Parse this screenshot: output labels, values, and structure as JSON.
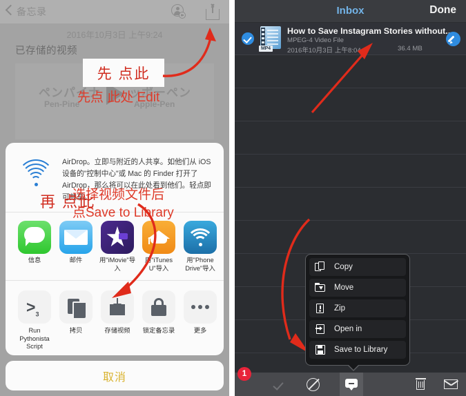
{
  "left_panel": {
    "header": {
      "back_label": "备忘录",
      "add_person_icon": "add-person-icon",
      "share_icon": "share-icon"
    },
    "date": "2016年10月3日 上午9:24",
    "note_title": "已存储的视频",
    "thumbnail": {
      "jp_left": "ペンパイナ",
      "en_left": "Pen-Pine",
      "jp_right": "ッポーペン",
      "en_right": "Apple-Pen",
      "play_icon": "play-icon"
    },
    "annotation_1": "先 点此",
    "annotation_2": "再 点此",
    "airdrop": {
      "icon": "airdrop-icon",
      "text": "AirDrop。立即与附近的人共享。如他们从 iOS 设备的\"控制中心\"或 Mac 的 Finder 打开了 AirDrop，那么将可以在此处看到他们。轻点即可共享。"
    },
    "apps": [
      {
        "label": "信息",
        "icon": "messages-icon"
      },
      {
        "label": "邮件",
        "icon": "mail-icon"
      },
      {
        "label": "用\"iMovie\"导入",
        "icon": "imovie-icon"
      },
      {
        "label": "用\"iTunes U\"导入",
        "icon": "itunes-u-icon"
      },
      {
        "label": "用\"Phone Drive\"导入",
        "icon": "phone-drive-icon"
      }
    ],
    "actions": [
      {
        "label": "Run Pythonista Script",
        "icon": "pythonista-icon"
      },
      {
        "label": "拷贝",
        "icon": "copy-icon"
      },
      {
        "label": "存储视频",
        "icon": "save-video-icon"
      },
      {
        "label": "锁定备忘录",
        "icon": "lock-icon"
      },
      {
        "label": "更多",
        "icon": "more-icon"
      }
    ],
    "cancel_label": "取消"
  },
  "right_panel": {
    "header": {
      "title": "Inbox",
      "done_label": "Done"
    },
    "file": {
      "name": "How to Save Instagram Stories without..",
      "type": "MPEG-4 Video File",
      "date": "2016年10月3日 上午8:04",
      "size": "36.4 MB",
      "file_icon": "mp4-file-icon",
      "check_icon": "checkmark-icon",
      "edit_icon": "pencil-icon"
    },
    "annotation_edit": "先点 此处 Edit",
    "annotation_save": "选择视频文件后\n点Save to Library",
    "annotation_save_line1": "选择视频文件后",
    "annotation_save_line2": "点Save to Library",
    "context_menu": [
      {
        "label": "Copy",
        "icon": "copy-icon"
      },
      {
        "label": "Move",
        "icon": "folder-move-icon"
      },
      {
        "label": "Zip",
        "icon": "zip-icon"
      },
      {
        "label": "Open in",
        "icon": "open-in-icon"
      },
      {
        "label": "Save to Library",
        "icon": "save-disk-icon"
      }
    ],
    "toolbar": {
      "badge_count": "1",
      "items": [
        {
          "icon": "checkmark-icon"
        },
        {
          "icon": "deselect-icon"
        },
        {
          "icon": "speech-bubble-minus-icon"
        },
        {
          "icon": "trash-icon"
        },
        {
          "icon": "envelope-icon"
        }
      ]
    }
  },
  "colors": {
    "annotation_red": "#d02b1e",
    "accent_blue": "#2f8ce0",
    "title_blue": "#73b4e8",
    "cancel_gold": "#d9b330",
    "badge_red": "#e8243a"
  }
}
